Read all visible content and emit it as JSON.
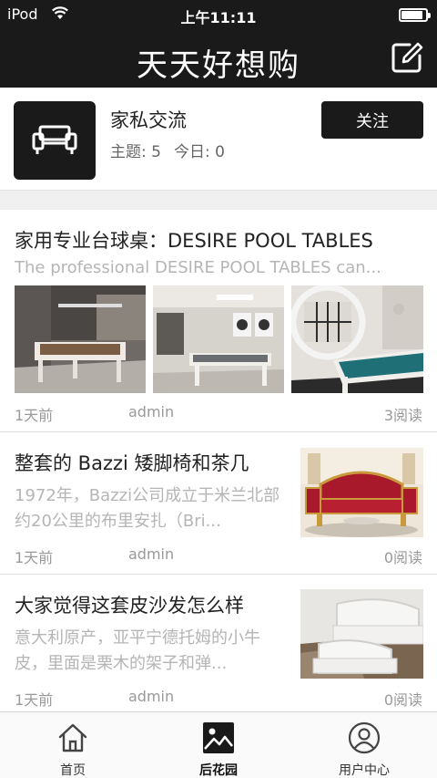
{
  "status_bar": {
    "carrier": "iPod",
    "time": "上午11:11",
    "battery_level": 0.9
  },
  "nav": {
    "title": "天天好想购",
    "edit_icon": "edit-icon"
  },
  "forum": {
    "icon": "sofa-icon",
    "name": "家私交流",
    "topics_label": "主题: 5",
    "today_label": "今日: 0",
    "follow_label": "关注"
  },
  "posts": [
    {
      "title": "家用专业台球桌：DESIRE POOL TABLES",
      "summary": "The professional DESIRE POOL TABLES  can...",
      "age": "1天前",
      "author": "admin",
      "reads": "3阅读"
    },
    {
      "title": "整套的 Bazzi 矮脚椅和茶几",
      "summary": "1972年，Bazzi公司成立于米兰北部约20公里的布里安扎（Bri...",
      "age": "1天前",
      "author": "admin",
      "reads": "0阅读"
    },
    {
      "title": "大家觉得这套皮沙发怎么样",
      "summary": "意大利原产，亚平宁德托姆的小牛皮，里面是栗木的架子和弹...",
      "age": "1天前",
      "author": "admin",
      "reads": "0阅读"
    }
  ],
  "tabs": [
    {
      "label": "首页",
      "icon": "home-icon"
    },
    {
      "label": "后花园",
      "icon": "garden-icon"
    },
    {
      "label": "用户中心",
      "icon": "user-icon"
    }
  ],
  "active_tab": "后花园"
}
